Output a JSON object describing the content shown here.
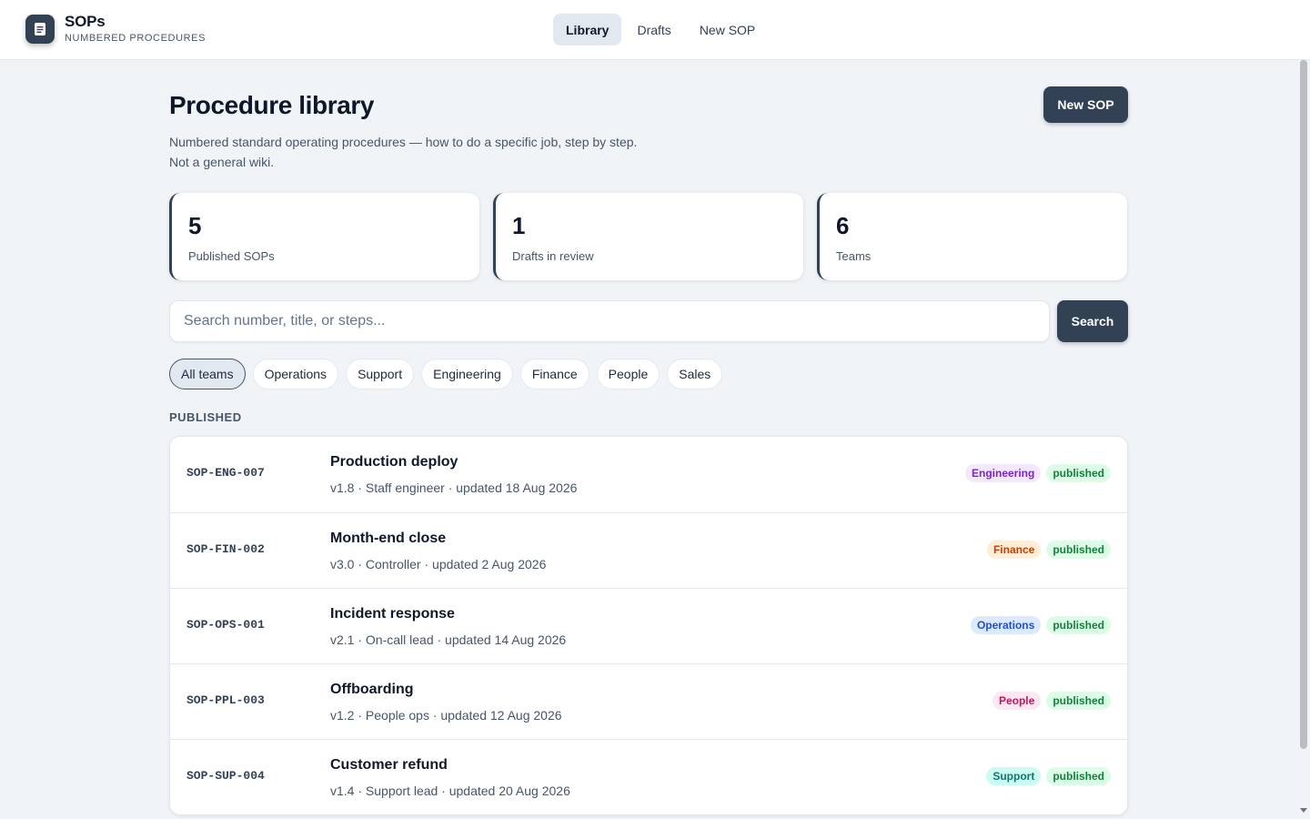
{
  "brand": {
    "title": "SOPs",
    "subtitle": "NUMBERED PROCEDURES",
    "icon": "document-icon"
  },
  "nav": [
    {
      "label": "Library",
      "active": true
    },
    {
      "label": "Drafts",
      "active": false
    },
    {
      "label": "New SOP",
      "active": false
    }
  ],
  "page": {
    "title": "Procedure library",
    "description": "Numbered standard operating procedures — how to do a specific job, step by step. Not a general wiki.",
    "new_button": "New SOP"
  },
  "stats": [
    {
      "value": "5",
      "label": "Published SOPs"
    },
    {
      "value": "1",
      "label": "Drafts in review"
    },
    {
      "value": "6",
      "label": "Teams"
    }
  ],
  "search": {
    "placeholder": "Search number, title, or steps...",
    "value": "",
    "button": "Search"
  },
  "filters": [
    {
      "label": "All teams",
      "active": true
    },
    {
      "label": "Operations",
      "active": false
    },
    {
      "label": "Support",
      "active": false
    },
    {
      "label": "Engineering",
      "active": false
    },
    {
      "label": "Finance",
      "active": false
    },
    {
      "label": "People",
      "active": false
    },
    {
      "label": "Sales",
      "active": false
    }
  ],
  "section_label": "PUBLISHED",
  "team_colors": {
    "Engineering": {
      "bg": "#f3e8ff",
      "fg": "#7e22ce"
    },
    "Finance": {
      "bg": "#ffedd5",
      "fg": "#c2410c"
    },
    "Operations": {
      "bg": "#dbeafe",
      "fg": "#1d4ed8"
    },
    "People": {
      "bg": "#fce7f3",
      "fg": "#be185d"
    },
    "Support": {
      "bg": "#ccfbf1",
      "fg": "#0f766e"
    }
  },
  "status_color": {
    "bg": "#dcfce7",
    "fg": "#15803d"
  },
  "sops": [
    {
      "code": "SOP-ENG-007",
      "title": "Production deploy",
      "meta": "v1.8 · Staff engineer · updated 18 Aug 2026",
      "team": "Engineering",
      "status": "published"
    },
    {
      "code": "SOP-FIN-002",
      "title": "Month-end close",
      "meta": "v3.0 · Controller · updated 2 Aug 2026",
      "team": "Finance",
      "status": "published"
    },
    {
      "code": "SOP-OPS-001",
      "title": "Incident response",
      "meta": "v2.1 · On-call lead · updated 14 Aug 2026",
      "team": "Operations",
      "status": "published"
    },
    {
      "code": "SOP-PPL-003",
      "title": "Offboarding",
      "meta": "v1.2 · People ops · updated 12 Aug 2026",
      "team": "People",
      "status": "published"
    },
    {
      "code": "SOP-SUP-004",
      "title": "Customer refund",
      "meta": "v1.4 · Support lead · updated 20 Aug 2026",
      "team": "Support",
      "status": "published"
    }
  ]
}
